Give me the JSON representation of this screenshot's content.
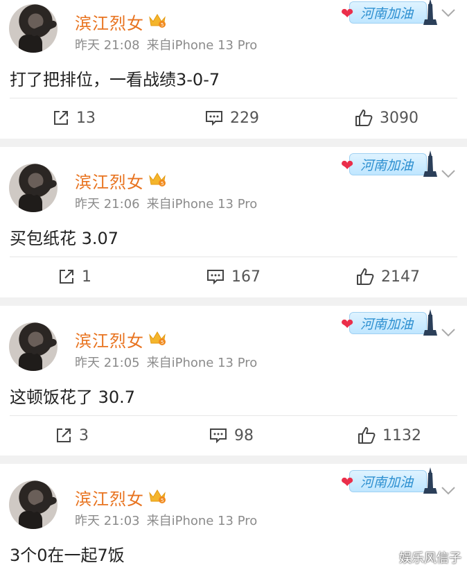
{
  "posts": [
    {
      "username": "滨江烈女",
      "time": "昨天 21:08",
      "source": "来自iPhone 13 Pro",
      "badge_text": "河南加油",
      "content": "打了把排位，一看战绩3-0-7",
      "reposts": "13",
      "comments": "229",
      "likes": "3090"
    },
    {
      "username": "滨江烈女",
      "time": "昨天 21:06",
      "source": "来自iPhone 13 Pro",
      "badge_text": "河南加油",
      "content": "买包纸花 3.07",
      "reposts": "1",
      "comments": "167",
      "likes": "2147"
    },
    {
      "username": "滨江烈女",
      "time": "昨天 21:05",
      "source": "来自iPhone 13 Pro",
      "badge_text": "河南加油",
      "content": "这顿饭花了 30.7",
      "reposts": "3",
      "comments": "98",
      "likes": "1132"
    },
    {
      "username": "滨江烈女",
      "time": "昨天 21:03",
      "source": "来自iPhone 13 Pro",
      "badge_text": "河南加油",
      "content": "3个0在一起7饭"
    }
  ],
  "watermark": "娱乐风信子",
  "colors": {
    "username": "#e8731f",
    "meta": "#8b8b8b",
    "separator": "#f1f1f1",
    "badge_text": "#2c8fd0"
  },
  "icons": [
    "repost-icon",
    "comment-icon",
    "like-icon",
    "vip-crown-icon",
    "chevron-down-icon",
    "heart-icon",
    "tower-icon"
  ]
}
